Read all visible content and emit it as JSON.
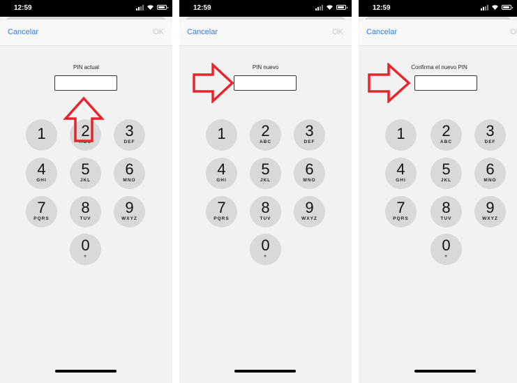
{
  "status_bar": {
    "time": "12:59"
  },
  "nav": {
    "cancel_label": "Cancelar",
    "ok_label": "OK"
  },
  "screens": [
    {
      "pin_label": "PIN actual"
    },
    {
      "pin_label": "PIN nuevo"
    },
    {
      "pin_label": "Confirma el nuevo PIN"
    }
  ],
  "keypad": [
    {
      "digit": "1",
      "letters": ""
    },
    {
      "digit": "2",
      "letters": "ABC"
    },
    {
      "digit": "3",
      "letters": "DEF"
    },
    {
      "digit": "4",
      "letters": "GHI"
    },
    {
      "digit": "5",
      "letters": "JKL"
    },
    {
      "digit": "6",
      "letters": "MNO"
    },
    {
      "digit": "7",
      "letters": "PQRS"
    },
    {
      "digit": "8",
      "letters": "TUV"
    },
    {
      "digit": "9",
      "letters": "WXYZ"
    },
    {
      "digit": "0",
      "letters": "+"
    }
  ],
  "annotation": {
    "arrow_color": "#e8232a"
  }
}
